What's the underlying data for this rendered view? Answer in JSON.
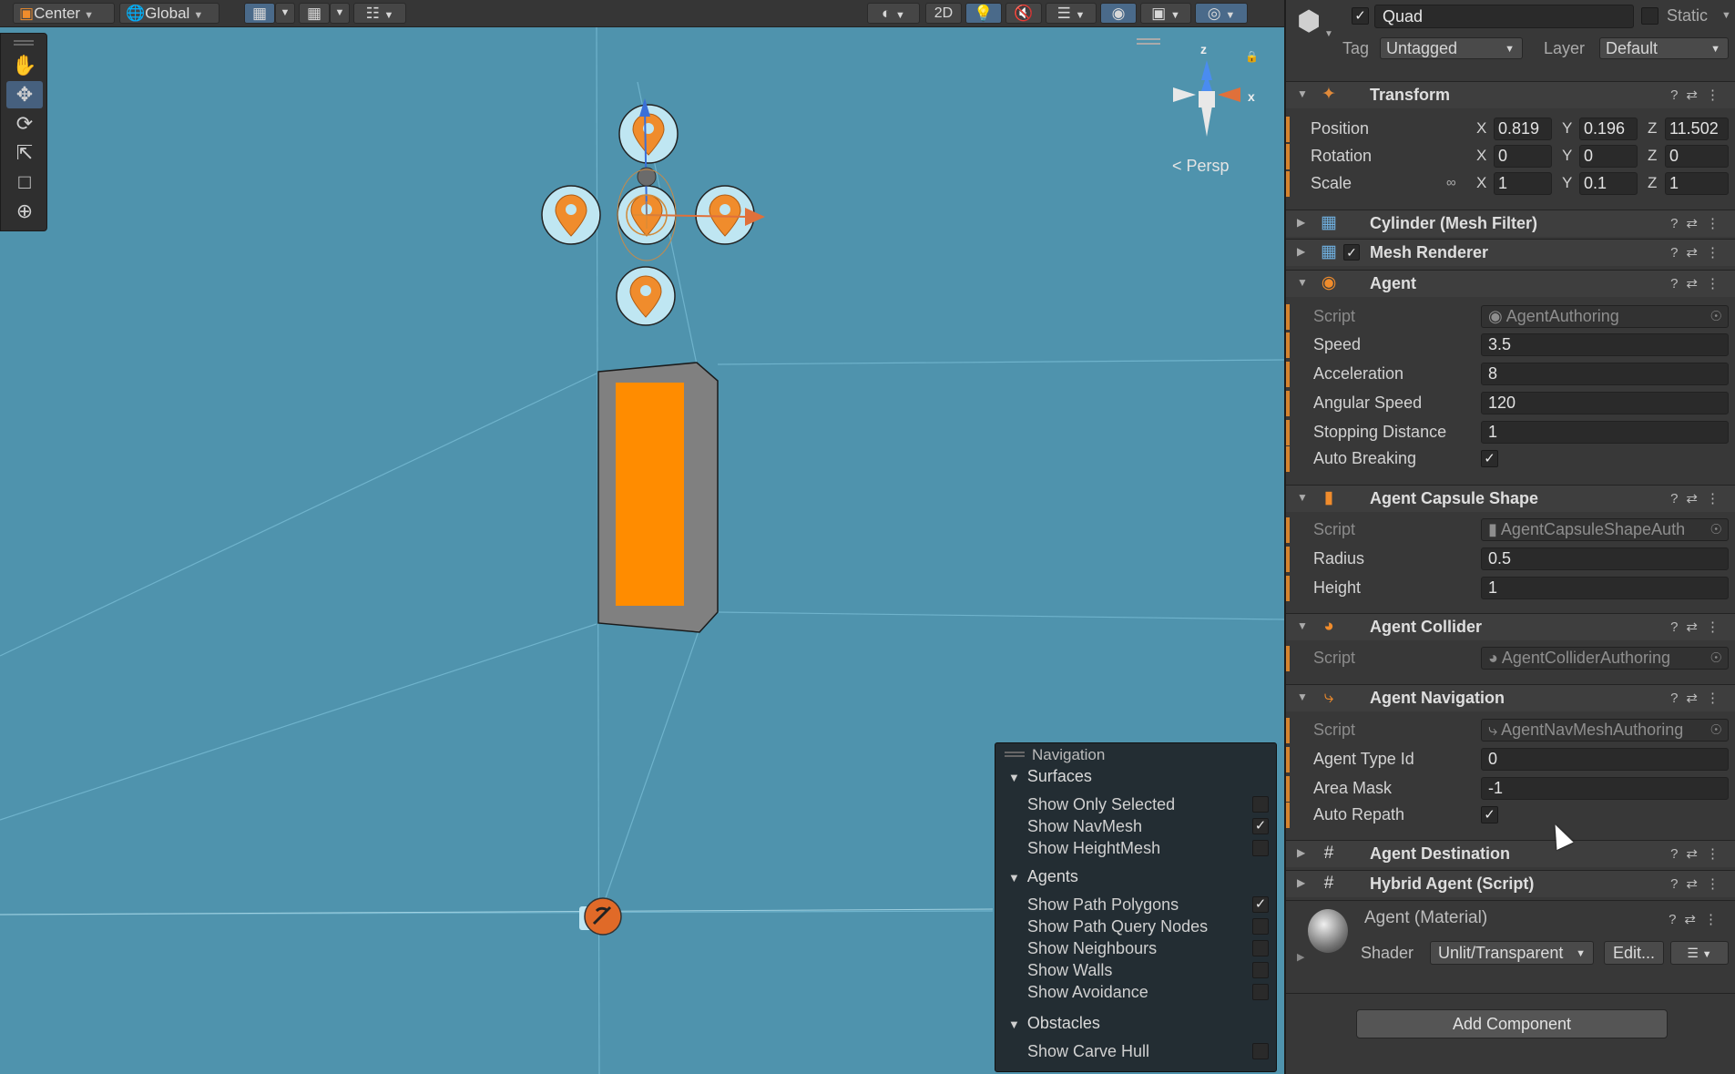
{
  "toolbar": {
    "pivot": "Center",
    "space": "Global",
    "view2d": "2D"
  },
  "scene": {
    "persp_label": "Persp",
    "axis_x": "x",
    "axis_z": "z"
  },
  "tools": [
    "hand-tool",
    "move-tool",
    "rotate-tool",
    "scale-tool",
    "rect-tool",
    "transform-tool"
  ],
  "navigation": {
    "title": "Navigation",
    "surfaces": {
      "label": "Surfaces",
      "rows": [
        {
          "label": "Show Only Selected",
          "checked": false
        },
        {
          "label": "Show NavMesh",
          "checked": true
        },
        {
          "label": "Show HeightMesh",
          "checked": false
        }
      ]
    },
    "agents": {
      "label": "Agents",
      "rows": [
        {
          "label": "Show Path Polygons",
          "checked": true
        },
        {
          "label": "Show Path Query Nodes",
          "checked": false
        },
        {
          "label": "Show Neighbours",
          "checked": false
        },
        {
          "label": "Show Walls",
          "checked": false
        },
        {
          "label": "Show Avoidance",
          "checked": false
        }
      ]
    },
    "obstacles": {
      "label": "Obstacles",
      "rows": [
        {
          "label": "Show Carve Hull",
          "checked": false
        }
      ]
    }
  },
  "inspector": {
    "object_name": "Quad",
    "static_label": "Static",
    "tag_label": "Tag",
    "tag_value": "Untagged",
    "layer_label": "Layer",
    "layer_value": "Default",
    "transform": {
      "title": "Transform",
      "position_label": "Position",
      "rotation_label": "Rotation",
      "scale_label": "Scale",
      "position": {
        "x": "0.819",
        "y": "0.196",
        "z": "11.502"
      },
      "rotation": {
        "x": "0",
        "y": "0",
        "z": "0"
      },
      "scale": {
        "x": "1",
        "y": "0.1",
        "z": "1"
      }
    },
    "mesh_filter": {
      "title": "Cylinder (Mesh Filter)"
    },
    "mesh_renderer": {
      "title": "Mesh Renderer"
    },
    "agent": {
      "title": "Agent",
      "script_label": "Script",
      "script": "AgentAuthoring",
      "speed_label": "Speed",
      "speed": "3.5",
      "acceleration_label": "Acceleration",
      "acceleration": "8",
      "angular_speed_label": "Angular Speed",
      "angular_speed": "120",
      "stopping_distance_label": "Stopping Distance",
      "stopping_distance": "1",
      "auto_breaking_label": "Auto Breaking"
    },
    "capsule": {
      "title": "Agent Capsule Shape",
      "script_label": "Script",
      "script": "AgentCapsuleShapeAuth",
      "radius_label": "Radius",
      "radius": "0.5",
      "height_label": "Height",
      "height": "1"
    },
    "collider": {
      "title": "Agent Collider",
      "script_label": "Script",
      "script": "AgentColliderAuthoring"
    },
    "navigation": {
      "title": "Agent Navigation",
      "script_label": "Script",
      "script": "AgentNavMeshAuthoring",
      "agent_type_id_label": "Agent Type Id",
      "agent_type_id": "0",
      "area_mask_label": "Area Mask",
      "area_mask": "-1",
      "auto_repath_label": "Auto Repath"
    },
    "destination": {
      "title": "Agent Destination"
    },
    "hybrid": {
      "title": "Hybrid Agent (Script)"
    },
    "material": {
      "name": "Agent (Material)",
      "shader_label": "Shader",
      "shader": "Unlit/Transparent",
      "edit_label": "Edit..."
    },
    "add_component": "Add Component"
  },
  "colors": {
    "scene_bg": "#4f93ad",
    "accent_orange": "#ff8c00",
    "agent_blue": "#bfe6f2"
  }
}
